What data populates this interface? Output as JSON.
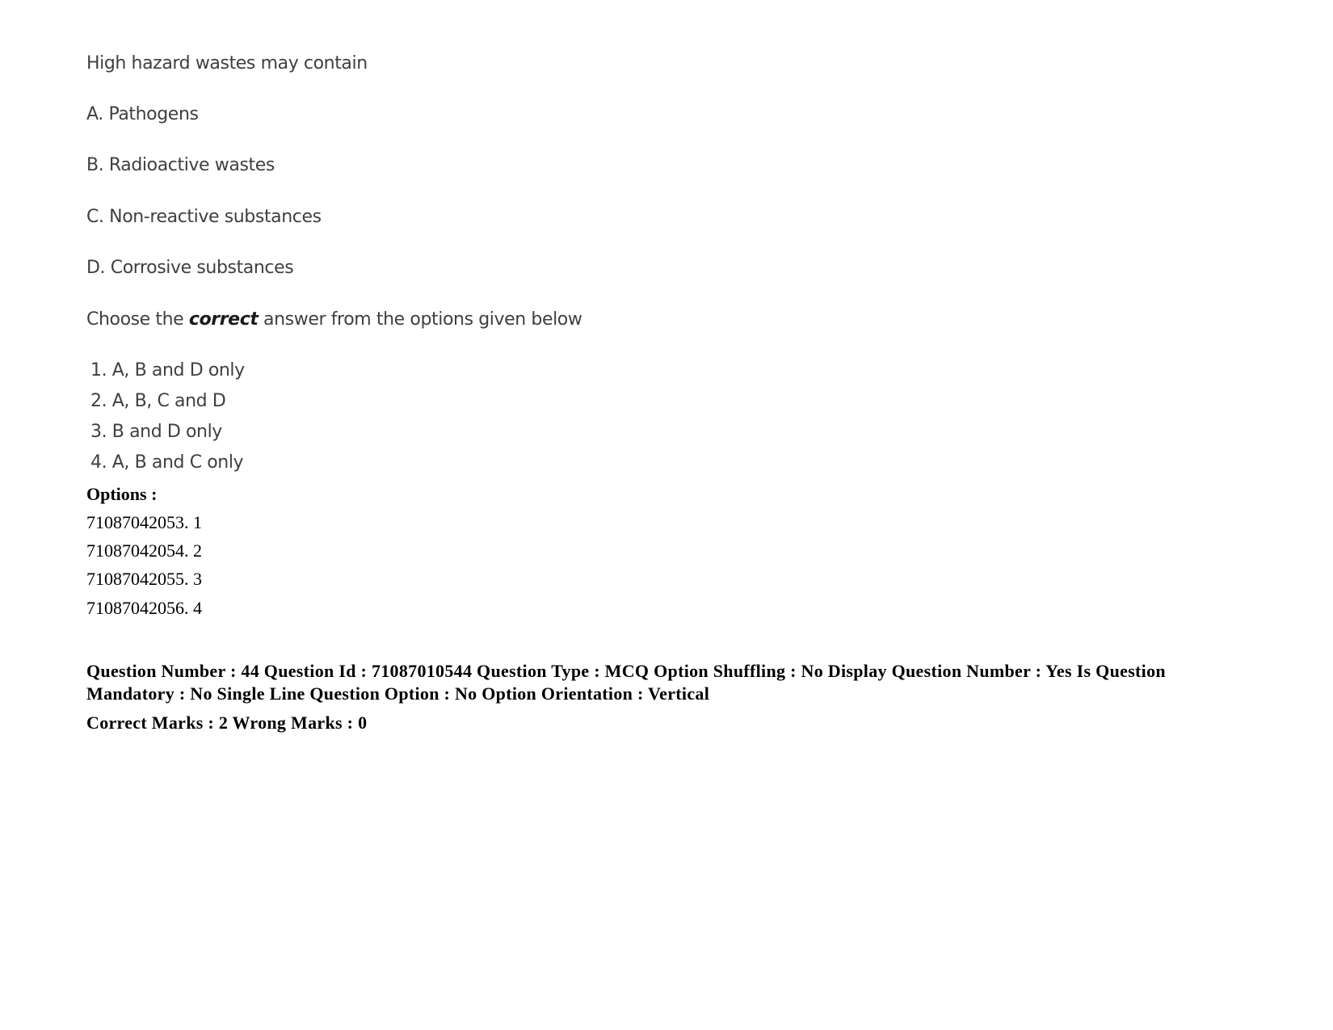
{
  "question": {
    "title": "High hazard wastes may contain",
    "statements": [
      "A. Pathogens",
      "B. Radioactive wastes",
      "C. Non-reactive substances",
      "D. Corrosive substances"
    ],
    "instruction": {
      "prefix": "Choose the ",
      "emphasis": "correct",
      "suffix": " answer from the options given below"
    },
    "choices": [
      "1. A, B and D only",
      "2. A, B, C and D",
      "3. B and D only",
      "4. A, B and C only"
    ]
  },
  "options": {
    "label": "Options :",
    "items": [
      "71087042053. 1",
      "71087042054. 2",
      "71087042055. 3",
      "71087042056. 4"
    ]
  },
  "metadata": {
    "details": "Question Number : 44 Question Id : 71087010544 Question Type : MCQ Option Shuffling : No Display Question Number : Yes Is Question Mandatory : No Single Line Question Option : No Option Orientation : Vertical",
    "marks": "Correct Marks : 2 Wrong Marks : 0"
  }
}
